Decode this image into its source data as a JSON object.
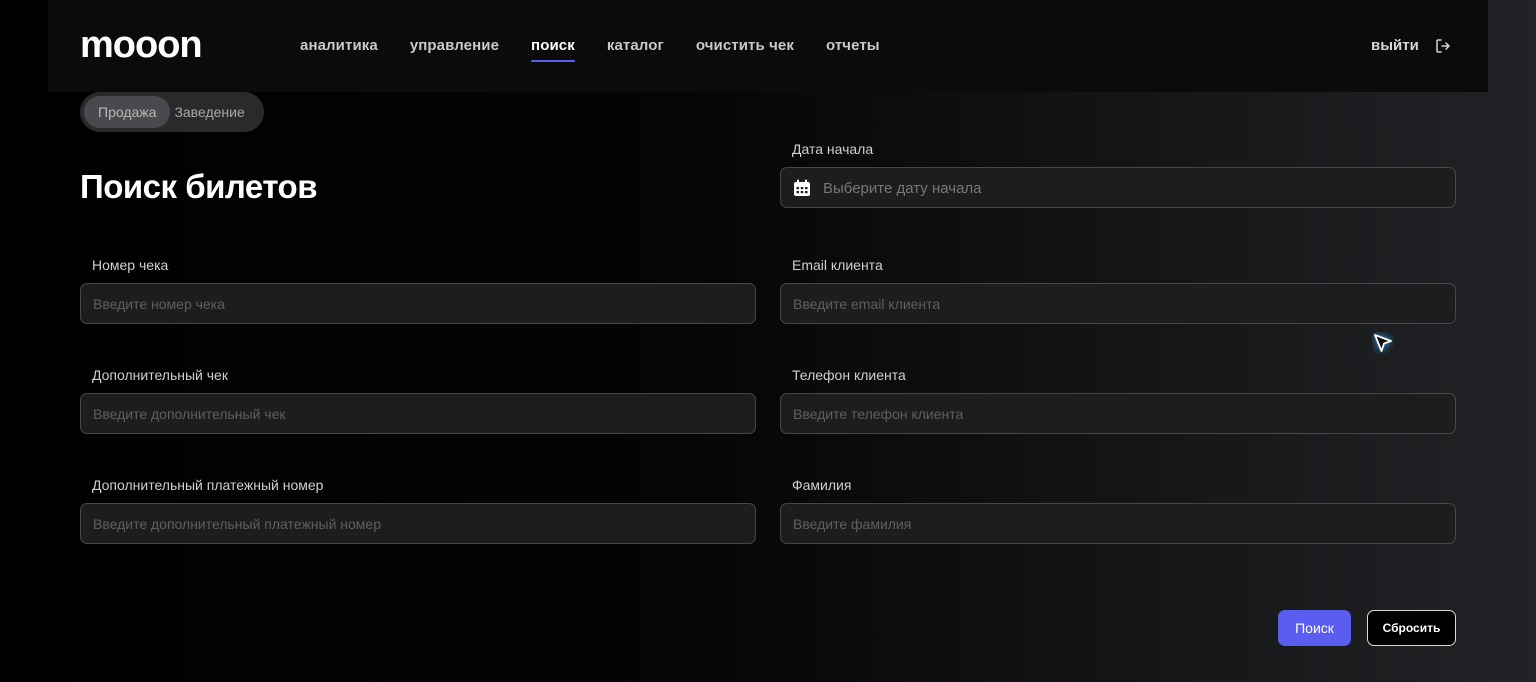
{
  "header": {
    "logo": "mooon",
    "nav": [
      {
        "label": "аналитика"
      },
      {
        "label": "управление"
      },
      {
        "label": "поиск"
      },
      {
        "label": "каталог"
      },
      {
        "label": "очистить чек"
      },
      {
        "label": "отчеты"
      }
    ],
    "active_nav": "поиск",
    "logout_label": "выйти"
  },
  "mode_toggle": {
    "options": [
      "Продажа",
      "Заведение"
    ],
    "selected": "Продажа"
  },
  "page_title": "Поиск билетов",
  "form": {
    "start_date": {
      "label": "Дата начала",
      "placeholder": "Выберите дату начала"
    },
    "receipt_number": {
      "label": "Номер чека",
      "placeholder": "Введите номер чека"
    },
    "client_email": {
      "label": "Email клиента",
      "placeholder": "Введите email клиента"
    },
    "additional_receipt": {
      "label": "Дополнительный чек",
      "placeholder": "Введите дополнительный чек"
    },
    "client_phone": {
      "label": "Телефон клиента",
      "placeholder": "Введите телефон клиента"
    },
    "additional_payment_number": {
      "label": "Дополнительный платежный номер",
      "placeholder": "Введите дополнительный платежный номер"
    },
    "last_name": {
      "label": "Фамилия",
      "placeholder": "Введите фамилия"
    }
  },
  "actions": {
    "search_label": "Поиск",
    "reset_label": "Сбросить"
  },
  "colors": {
    "accent": "#5a5df0",
    "background": "#000000",
    "input_bg": "#1d1d1f"
  },
  "icons": [
    "calendar-icon",
    "logout-icon",
    "cursor-arrow-icon"
  ]
}
